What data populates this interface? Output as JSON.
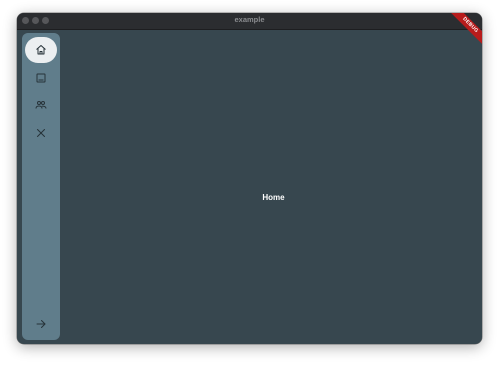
{
  "window": {
    "title": "example"
  },
  "navigation_rail": {
    "items": [
      {
        "icon": "home-icon",
        "selected": true
      },
      {
        "icon": "image-icon",
        "selected": false
      },
      {
        "icon": "people-icon",
        "selected": false
      },
      {
        "icon": "close-icon",
        "selected": false
      }
    ],
    "trailing_icon": "arrow-right-icon"
  },
  "main": {
    "label": "Home"
  },
  "debug_banner": {
    "label": "DEBUG"
  },
  "colors": {
    "background": "#37474f",
    "rail": "#607d8b",
    "selected_indicator": "#eceff1",
    "banner": "#b71c1c"
  }
}
